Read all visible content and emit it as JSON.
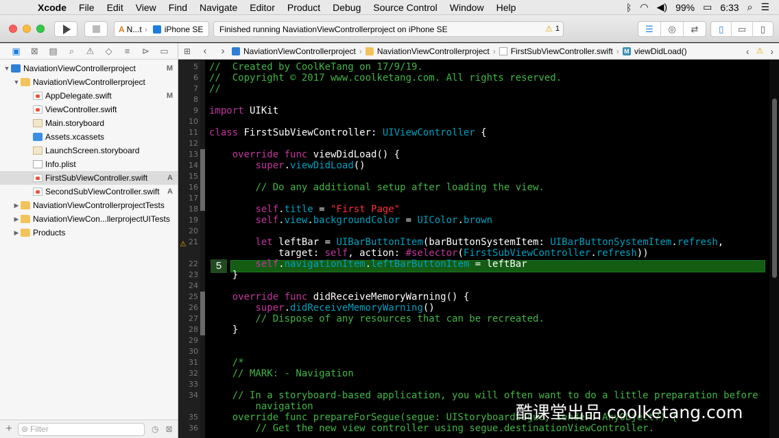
{
  "menubar": {
    "app": "Xcode",
    "items": [
      "File",
      "Edit",
      "View",
      "Find",
      "Navigate",
      "Editor",
      "Product",
      "Debug",
      "Source Control",
      "Window",
      "Help"
    ],
    "battery": "99%",
    "time": "6:33"
  },
  "toolbar": {
    "scheme": "N...t",
    "device": "iPhone SE",
    "activity": "Finished running NaviationViewControllerproject on iPhone SE",
    "warning_count": "1"
  },
  "navigator": {
    "tree": [
      {
        "label": "NaviationViewControllerproject",
        "badge": "M",
        "type": "proj"
      },
      {
        "label": "NaviationViewControllerproject",
        "badge": "",
        "type": "folder"
      },
      {
        "label": "AppDelegate.swift",
        "badge": "M",
        "type": "swift"
      },
      {
        "label": "ViewController.swift",
        "badge": "",
        "type": "swift"
      },
      {
        "label": "Main.storyboard",
        "badge": "",
        "type": "sb"
      },
      {
        "label": "Assets.xcassets",
        "badge": "",
        "type": "assets"
      },
      {
        "label": "LaunchScreen.storyboard",
        "badge": "",
        "type": "sb"
      },
      {
        "label": "Info.plist",
        "badge": "",
        "type": "plist"
      },
      {
        "label": "FirstSubViewController.swift",
        "badge": "A",
        "type": "swift"
      },
      {
        "label": "SecondSubViewController.swift",
        "badge": "A",
        "type": "swift"
      },
      {
        "label": "NaviationViewControllerprojectTests",
        "badge": "",
        "type": "folder"
      },
      {
        "label": "NaviationViewCon...llerprojectUITests",
        "badge": "",
        "type": "folder"
      },
      {
        "label": "Products",
        "badge": "",
        "type": "folder"
      }
    ],
    "filter_placeholder": "Filter"
  },
  "jumpbar": {
    "crumbs": [
      "NaviationViewControllerproject",
      "NaviationViewControllerproject",
      "FirstSubViewController.swift",
      "viewDidLoad()"
    ]
  },
  "editor": {
    "line_numbers": [
      "5",
      "6",
      "7",
      "8",
      "9",
      "10",
      "11",
      "12",
      "13",
      "14",
      "15",
      "16",
      "17",
      "18",
      "19",
      "20",
      "21",
      "",
      "22",
      "23",
      "24",
      "25",
      "26",
      "27",
      "28",
      "29",
      "30",
      "31",
      "32",
      "33",
      "34",
      "",
      "35",
      "36"
    ],
    "breakpoint_label": "5"
  },
  "watermark": "酷课堂出品 coolketang.com"
}
